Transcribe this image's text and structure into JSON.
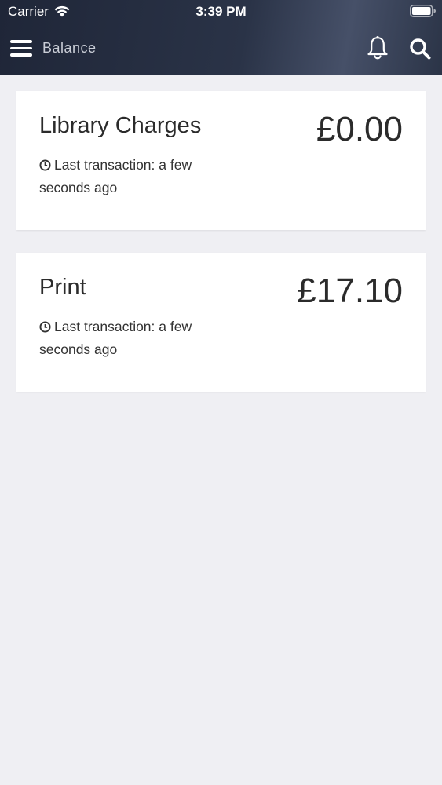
{
  "status_bar": {
    "carrier": "Carrier",
    "time": "3:39 PM"
  },
  "nav": {
    "title": "Balance",
    "menu_icon": "hamburger-menu-icon",
    "bell_icon": "bell-icon",
    "search_icon": "search-icon"
  },
  "accounts": [
    {
      "name": "Library Charges",
      "amount": "£0.00",
      "last_transaction": "Last transaction: a few seconds ago"
    },
    {
      "name": "Print",
      "amount": "£17.10",
      "last_transaction": "Last transaction: a few seconds ago"
    }
  ],
  "colors": {
    "header_bg": "#232b3d",
    "page_bg": "#efeff3",
    "card_bg": "#ffffff",
    "text": "#2b2b2b"
  }
}
